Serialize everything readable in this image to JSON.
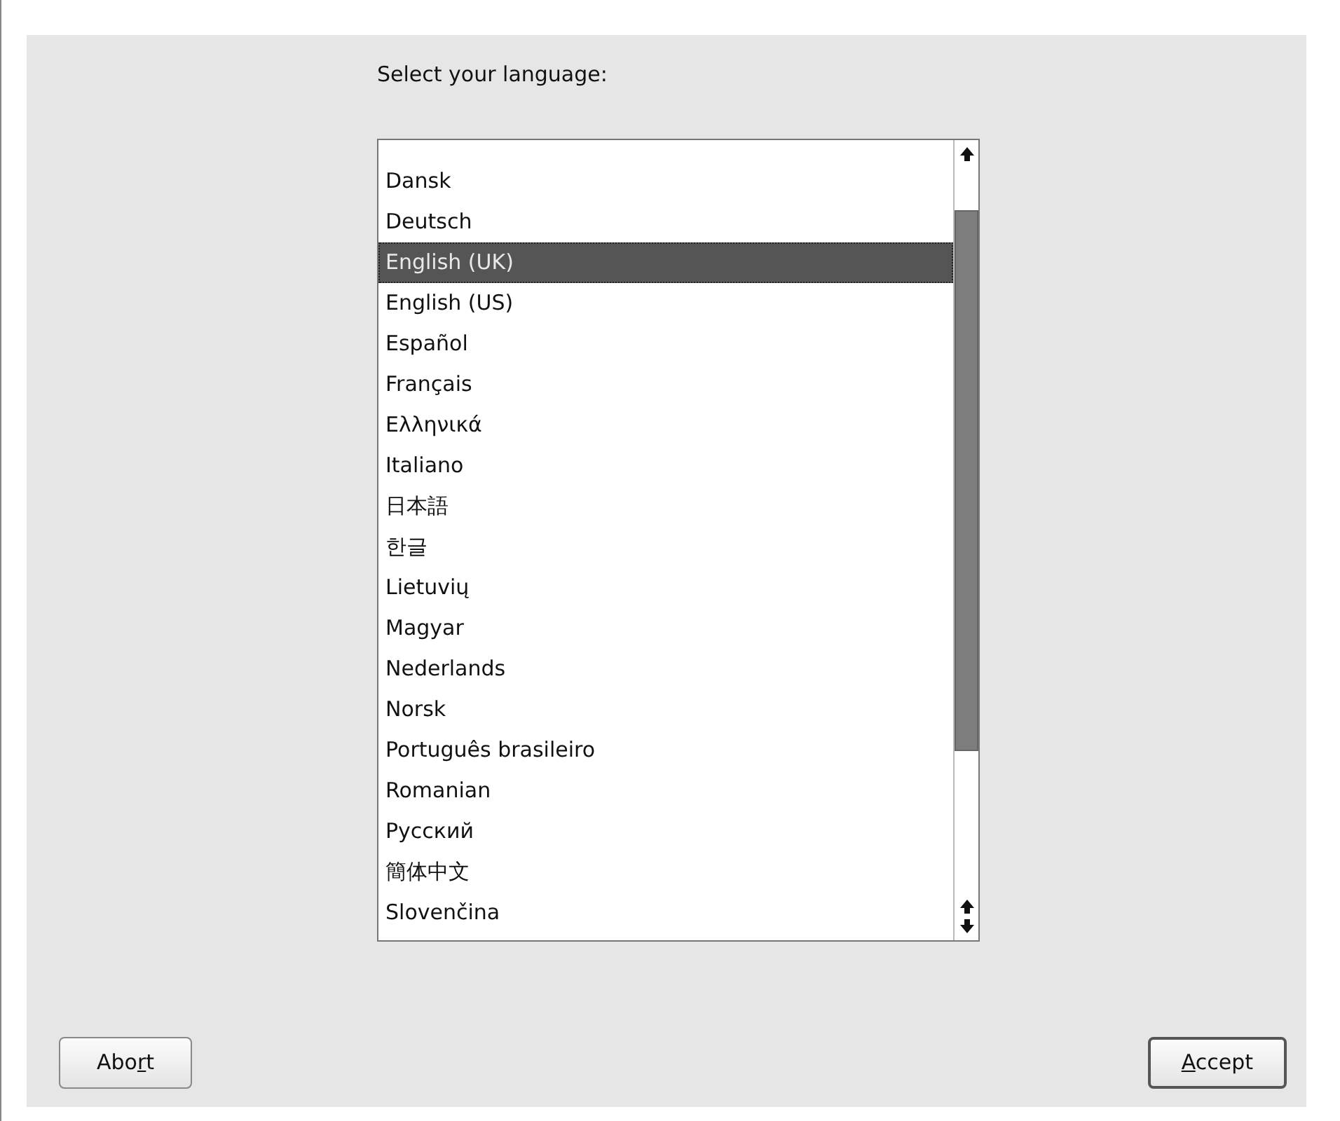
{
  "prompt": "Select your language:",
  "languages": [
    {
      "label": "Dansk",
      "selected": false
    },
    {
      "label": "Deutsch",
      "selected": false
    },
    {
      "label": "English (UK)",
      "selected": true
    },
    {
      "label": "English (US)",
      "selected": false
    },
    {
      "label": "Español",
      "selected": false
    },
    {
      "label": "Français",
      "selected": false
    },
    {
      "label": "Ελληνικά",
      "selected": false
    },
    {
      "label": "Italiano",
      "selected": false
    },
    {
      "label": "日本語",
      "selected": false
    },
    {
      "label": "한글",
      "selected": false
    },
    {
      "label": "Lietuvių",
      "selected": false
    },
    {
      "label": "Magyar",
      "selected": false
    },
    {
      "label": "Nederlands",
      "selected": false
    },
    {
      "label": "Norsk",
      "selected": false
    },
    {
      "label": "Português brasileiro",
      "selected": false
    },
    {
      "label": "Romanian",
      "selected": false
    },
    {
      "label": "Русский",
      "selected": false
    },
    {
      "label": "簡体中文",
      "selected": false
    },
    {
      "label": "Slovenčina",
      "selected": false
    }
  ],
  "buttons": [
    {
      "before": "Abo",
      "mnemonic": "r",
      "after": "t",
      "default": false
    },
    {
      "mnemonic": "A",
      "after": "ccept",
      "default": true
    }
  ]
}
